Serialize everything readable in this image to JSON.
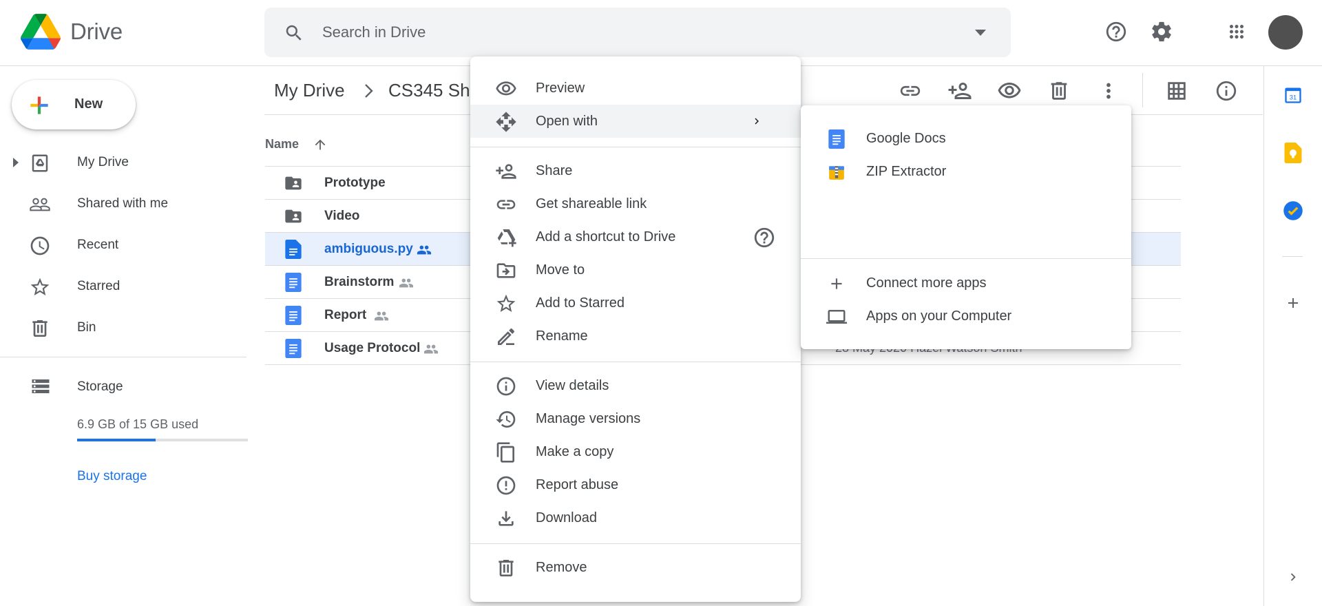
{
  "app": {
    "name": "Drive"
  },
  "search": {
    "placeholder": "Search in Drive"
  },
  "header_icons": [
    "help-icon",
    "settings-icon",
    "apps-grid-icon",
    "account-avatar"
  ],
  "sidebar": {
    "new_label": "New",
    "items": [
      {
        "label": "My Drive",
        "icon": "my-drive-icon"
      },
      {
        "label": "Shared with me",
        "icon": "people-icon"
      },
      {
        "label": "Recent",
        "icon": "clock-icon"
      },
      {
        "label": "Starred",
        "icon": "star-icon"
      },
      {
        "label": "Bin",
        "icon": "trash-icon"
      }
    ],
    "storage": {
      "label": "Storage",
      "usage_text": "6.9 GB of 15 GB used",
      "used_fraction": 0.46,
      "buy_label": "Buy storage"
    }
  },
  "breadcrumb": {
    "root": "My Drive",
    "current": "CS345 Sh"
  },
  "toolbar_icons": [
    "link-icon",
    "add-person-icon",
    "eye-icon",
    "trash-icon",
    "more-vert-icon",
    "grid-view-icon",
    "info-icon"
  ],
  "file_list": {
    "column_name": "Name",
    "rows": [
      {
        "name": "Prototype",
        "type": "shared-folder",
        "shared": false,
        "selected": false
      },
      {
        "name": "Video",
        "type": "shared-folder",
        "shared": false,
        "selected": false
      },
      {
        "name": "ambiguous.py",
        "type": "doc",
        "shared": true,
        "selected": true
      },
      {
        "name": "Brainstorm",
        "type": "doc",
        "shared": true,
        "selected": false
      },
      {
        "name": "Report",
        "type": "doc",
        "shared": true,
        "selected": false
      },
      {
        "name": "Usage Protocol",
        "type": "doc",
        "shared": true,
        "selected": false,
        "owner_partial": "28 May 2020 Hazel Watson Smith"
      }
    ]
  },
  "context_menu": {
    "items": [
      {
        "label": "Preview",
        "icon": "eye-icon"
      },
      {
        "label": "Open with",
        "icon": "open-with-icon",
        "highlighted": true,
        "has_submenu": true
      },
      {
        "label": "Share",
        "icon": "add-person-icon"
      },
      {
        "label": "Get shareable link",
        "icon": "link-icon"
      },
      {
        "label": "Add a shortcut to Drive",
        "icon": "shortcut-icon",
        "has_help": true
      },
      {
        "label": "Move to",
        "icon": "move-to-icon"
      },
      {
        "label": "Add to Starred",
        "icon": "star-icon"
      },
      {
        "label": "Rename",
        "icon": "pencil-icon"
      },
      {
        "label": "View details",
        "icon": "info-icon"
      },
      {
        "label": "Manage versions",
        "icon": "history-icon"
      },
      {
        "label": "Make a copy",
        "icon": "copy-icon"
      },
      {
        "label": "Report abuse",
        "icon": "report-icon"
      },
      {
        "label": "Download",
        "icon": "download-icon"
      },
      {
        "label": "Remove",
        "icon": "trash-icon"
      }
    ]
  },
  "open_with_submenu": {
    "apps": [
      {
        "label": "Google Docs",
        "icon": "google-docs-icon",
        "color": "#4285f4"
      },
      {
        "label": "ZIP Extractor",
        "icon": "zip-extractor-icon",
        "color": "#f4b400"
      }
    ],
    "more": [
      {
        "label": "Connect more apps",
        "icon": "plus-icon"
      },
      {
        "label": "Apps on your Computer",
        "icon": "laptop-icon"
      }
    ]
  },
  "right_rail_icons": [
    "calendar-icon",
    "keep-icon",
    "tasks-icon",
    "add-addon-icon",
    "expand-panel-icon"
  ],
  "colors": {
    "accent": "#1a73e8",
    "selected_row": "#e8f0fe",
    "icon_grey": "#5f6368"
  }
}
